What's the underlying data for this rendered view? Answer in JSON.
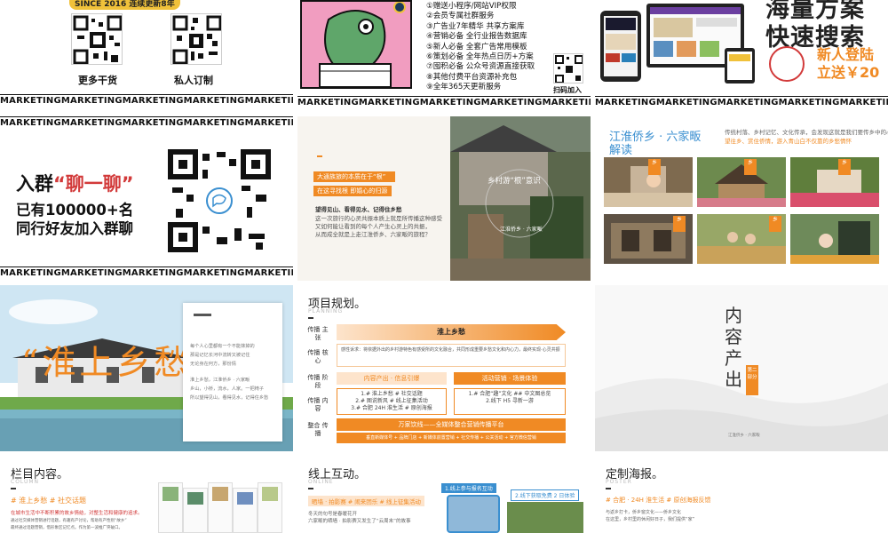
{
  "marketing_label": "MARKETING",
  "top_left": {
    "since": "SINCE 2016  连续更新8年",
    "qr_left_caption": "更多干货",
    "qr_right_caption": "私人订制"
  },
  "top_middle": {
    "items": [
      "①赠送小程序/网站VIP权限",
      "②会员专属社群服务",
      "③广告业7年精华 共享方案库",
      "④营销必备 全行业报告数据库",
      "⑤新人必备 全套广告常用模板",
      "⑥策划必备 全年热点日历+方案",
      "⑦囤积必备 公众号资源直接获取",
      "⑧其他付费平台资源补充包",
      "⑨全年365天更新服务"
    ],
    "scan_label": "扫码加入"
  },
  "top_right": {
    "title_line1": "海量方案",
    "title_line2": "快速搜索",
    "promo_line1": "新人登陆",
    "promo_line2": "立送￥20"
  },
  "join_group": {
    "title_prefix": "入群",
    "title_quote": "“聊一聊”",
    "sub_line1": "已有100000+名",
    "sub_line2": "同行好友加入群聊"
  },
  "roots_slide": {
    "orange1": "大通族旅的本质在于“根”",
    "orange2": "在这寻找根 即婚心的归源",
    "heading": "望得见山、看得见水、记得住乡愁",
    "body_lines": [
      "这一次旅行的心灵共振本质上就是所传播这种感受",
      "又如何能让看到的每个人产生心灵上的共振，",
      "从而成全就是上走江淮侨乡、六家畈的旅程？"
    ],
    "photo_title": "乡村游“根”意识",
    "photo_sub": "江淮侨乡 · 六家畈"
  },
  "village_slide": {
    "heading": "江淮侨乡 · 六家畈 解读",
    "desc_lines": [
      "传统村落、乡村记忆、文化传承，会发现这就是我们要传乡中的心灵故乡",
      "望往乡、赏住侨情，游入青山白不仅靠的乡愁情怀"
    ],
    "tags": [
      "乡",
      "乡",
      "乡",
      "乡",
      "乡"
    ]
  },
  "nostalgia_slide": {
    "big_title": "“淮上乡愁",
    "card_lines": [
      "每个人心里都有一个不能抹掉的",
      "那是记忆长河中流转又被记住",
      "无论身在何方，那份情",
      "",
      "淮上乡愁，江淮侨乡 · 六家畈",
      "乡山，小桥，流水，人家。一把椅子",
      "所以望得见山，看得见水，记得住乡愁"
    ]
  },
  "project_plan": {
    "title": "项目规划。",
    "subtitle": "PLANNING",
    "rows": [
      {
        "label": "传播\n主张",
        "content": "淮上乡愁"
      },
      {
        "label": "传播\n核心",
        "content": "感性诉求：将依据外出的乡村游特色有感受所的文化融合，共同形成重要乡愁文化和内心力，最终实现·心灵共振"
      },
      {
        "label": "传播\n阶段",
        "a": "内容产出 · 信息引爆",
        "b": "活动营销 · 场景体验"
      },
      {
        "label": "传播\n内容",
        "a": "1.# 淮上乡愁 # 社交话题\n2.# 图说新风 # 线上征集活动\n3.# 合肥 24H 淮生活 # 原创海报",
        "b": "1.# 合肥“趣”文化 ## 中文图总览\n2.线下 H5 寻新一游"
      },
      {
        "label": "整合\n传播",
        "content": "万家饮线——全媒体整合营销传播平台"
      }
    ],
    "bottom": "垂直新媒体号 + 品牌门店 + 新媒体前置营销 + 社交传播 + 公关活动 + 官方微信营销"
  },
  "content_output": {
    "title": "内容产出",
    "badge": "第二部分",
    "footer": "江淮侨乡 · 六家畈"
  },
  "columns_slide": {
    "title": "栏目内容。",
    "subtitle": "COLUMN",
    "hash": "# 淮上乡愁 # 社交话题",
    "red": "在城市生活中不断积累的故乡情结，对整生活和健康的追求。",
    "gray_lines": [
      "通过社交媒体营销进行话题，有趣有产讨论，帮助有产性别“故乡”",
      "最终通过话题营销，借形象区记忆点。作为第一波推广突破口。"
    ]
  },
  "online_slide": {
    "title": "线上互动。",
    "subtitle": "ONLINE",
    "pill": "晒墙 · 拍影赛 # 闹来团乐 # 线上征集活动",
    "gray_lines": [
      "冬天的句号是春暖花开",
      "六家畈的晒墙 · 拍影赛又发生了“云周末”的故事"
    ],
    "tab1": "1.线上参与报名互动",
    "tab2": "2.线下获取免费 2 日体验"
  },
  "poster_slide": {
    "title": "定制海报。",
    "subtitle": "POSTER",
    "hash": "# 合肥 · 24H 淮生活 # 原创海报反馈",
    "gray_lines": [
      "与返乡打卡，侨乡窗文化——侨乡文化",
      "在这里，乡村里的休闲好日子，我们提供“家”"
    ]
  },
  "colors": {
    "orange": "#f08a24",
    "blue": "#3a8fd0",
    "red": "#d23a3a",
    "yellow": "#f0c13a",
    "pink": "#f19dc0"
  }
}
